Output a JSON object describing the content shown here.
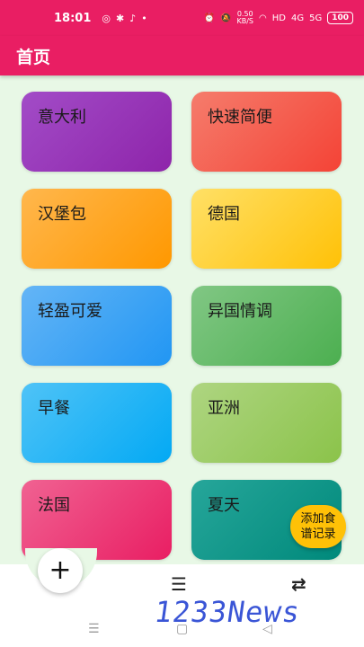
{
  "status_bar": {
    "time": "18:01",
    "left_icons": [
      "◎",
      "✱",
      "♪",
      "•"
    ],
    "net_speed_value": "0.50",
    "net_speed_unit": "KB/S",
    "hd": "HD",
    "signal_1": "4G",
    "signal_2": "5G",
    "battery": "100"
  },
  "app_bar": {
    "title": "首页"
  },
  "categories": [
    {
      "label": "意大利",
      "gradient": [
        "#a24cc7",
        "#8e24aa"
      ]
    },
    {
      "label": "快速简便",
      "gradient": [
        "#f57c6c",
        "#f44336"
      ]
    },
    {
      "label": "汉堡包",
      "gradient": [
        "#ffb74d",
        "#ff9800"
      ]
    },
    {
      "label": "德国",
      "gradient": [
        "#ffe066",
        "#ffc107"
      ]
    },
    {
      "label": "轻盈可爱",
      "gradient": [
        "#64b5f6",
        "#2196f3"
      ]
    },
    {
      "label": "异国情调",
      "gradient": [
        "#81c784",
        "#4caf50"
      ]
    },
    {
      "label": "早餐",
      "gradient": [
        "#4fc3f7",
        "#03a9f4"
      ]
    },
    {
      "label": "亚洲",
      "gradient": [
        "#aed581",
        "#8bc34a"
      ]
    },
    {
      "label": "法国",
      "gradient": [
        "#f06292",
        "#e91e63"
      ]
    },
    {
      "label": "夏天",
      "gradient": [
        "#26a69a",
        "#00897b"
      ]
    }
  ],
  "fab_recipe": {
    "line1": "添加食",
    "line2": "谱记录"
  },
  "fab_add": {
    "label": "+"
  },
  "bottom_nav": {
    "list_icon": "☰",
    "compare_icon": "⇄"
  },
  "system_nav": {
    "menu": "☰",
    "home": "▢",
    "back": "◁"
  },
  "watermark": "1233News"
}
